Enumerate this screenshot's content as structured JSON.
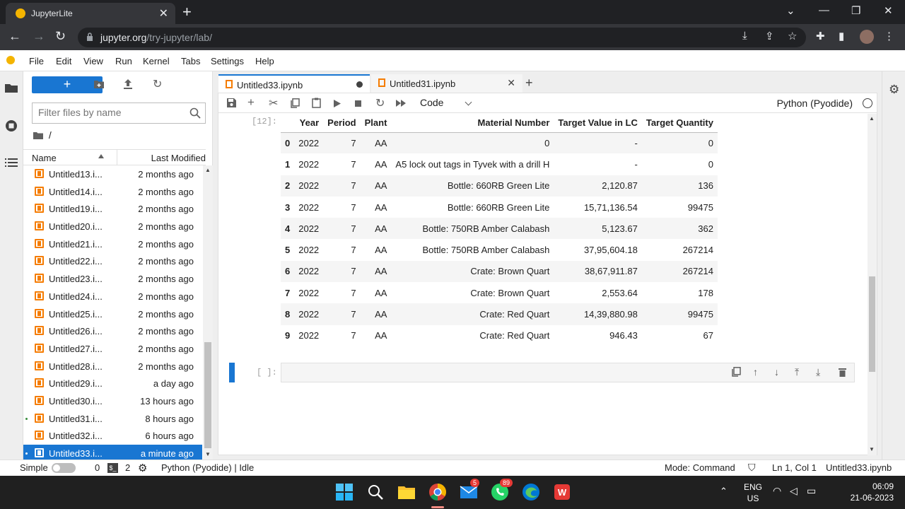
{
  "browser": {
    "tab_title": "JupyterLite",
    "url_domain": "jupyter.org",
    "url_path": "/try-jupyter/lab/"
  },
  "menu": [
    "File",
    "Edit",
    "View",
    "Run",
    "Kernel",
    "Tabs",
    "Settings",
    "Help"
  ],
  "filebrowser": {
    "new_label": "+",
    "filter_placeholder": "Filter files by name",
    "breadcrumb": "/",
    "col_name": "Name",
    "col_modified": "Last Modified",
    "files": [
      {
        "name": "Untitled13.i...",
        "modified": "2 months ago",
        "running": false,
        "selected": false
      },
      {
        "name": "Untitled14.i...",
        "modified": "2 months ago",
        "running": false,
        "selected": false
      },
      {
        "name": "Untitled19.i...",
        "modified": "2 months ago",
        "running": false,
        "selected": false
      },
      {
        "name": "Untitled20.i...",
        "modified": "2 months ago",
        "running": false,
        "selected": false
      },
      {
        "name": "Untitled21.i...",
        "modified": "2 months ago",
        "running": false,
        "selected": false
      },
      {
        "name": "Untitled22.i...",
        "modified": "2 months ago",
        "running": false,
        "selected": false
      },
      {
        "name": "Untitled23.i...",
        "modified": "2 months ago",
        "running": false,
        "selected": false
      },
      {
        "name": "Untitled24.i...",
        "modified": "2 months ago",
        "running": false,
        "selected": false
      },
      {
        "name": "Untitled25.i...",
        "modified": "2 months ago",
        "running": false,
        "selected": false
      },
      {
        "name": "Untitled26.i...",
        "modified": "2 months ago",
        "running": false,
        "selected": false
      },
      {
        "name": "Untitled27.i...",
        "modified": "2 months ago",
        "running": false,
        "selected": false
      },
      {
        "name": "Untitled28.i...",
        "modified": "2 months ago",
        "running": false,
        "selected": false
      },
      {
        "name": "Untitled29.i...",
        "modified": "a day ago",
        "running": false,
        "selected": false
      },
      {
        "name": "Untitled30.i...",
        "modified": "13 hours ago",
        "running": false,
        "selected": false
      },
      {
        "name": "Untitled31.i...",
        "modified": "8 hours ago",
        "running": true,
        "selected": false
      },
      {
        "name": "Untitled32.i...",
        "modified": "6 hours ago",
        "running": false,
        "selected": false
      },
      {
        "name": "Untitled33.i...",
        "modified": "a minute ago",
        "running": true,
        "selected": true
      }
    ]
  },
  "doc_tabs": [
    {
      "label": "Untitled33.ipynb",
      "active": true,
      "dirty": true
    },
    {
      "label": "Untitled31.ipynb",
      "active": false,
      "dirty": false
    }
  ],
  "notebook_toolbar": {
    "cell_type": "Code",
    "kernel_name": "Python (Pyodide)"
  },
  "output": {
    "prompt": "[12]:",
    "columns": [
      "",
      "Year",
      "Period",
      "Plant",
      "Material Number",
      "Target Value in LC",
      "Target Quantity"
    ],
    "rows": [
      [
        "0",
        "2022",
        "7",
        "AA",
        "0",
        "-",
        "0"
      ],
      [
        "1",
        "2022",
        "7",
        "AA",
        "A5 lock out tags in Tyvek with a drill H",
        "-",
        "0"
      ],
      [
        "2",
        "2022",
        "7",
        "AA",
        "Bottle: 660RB Green Lite",
        "2,120.87",
        "136"
      ],
      [
        "3",
        "2022",
        "7",
        "AA",
        "Bottle: 660RB Green Lite",
        "15,71,136.54",
        "99475"
      ],
      [
        "4",
        "2022",
        "7",
        "AA",
        "Bottle: 750RB Amber Calabash",
        "5,123.67",
        "362"
      ],
      [
        "5",
        "2022",
        "7",
        "AA",
        "Bottle: 750RB Amber Calabash",
        "37,95,604.18",
        "267214"
      ],
      [
        "6",
        "2022",
        "7",
        "AA",
        "Crate: Brown Quart",
        "38,67,911.87",
        "267214"
      ],
      [
        "7",
        "2022",
        "7",
        "AA",
        "Crate: Brown Quart",
        "2,553.64",
        "178"
      ],
      [
        "8",
        "2022",
        "7",
        "AA",
        "Crate: Red Quart",
        "14,39,880.98",
        "99475"
      ],
      [
        "9",
        "2022",
        "7",
        "AA",
        "Crate: Red Quart",
        "946.43",
        "67"
      ]
    ]
  },
  "empty_cell_prompt": "[ ]:",
  "statusbar": {
    "simple": "Simple",
    "terminals": "0",
    "kernels": "2",
    "kernel_status": "Python (Pyodide) | Idle",
    "mode": "Mode: Command",
    "cursor": "Ln 1, Col 1",
    "filename": "Untitled33.ipynb"
  },
  "taskbar": {
    "mail_badge": "5",
    "whatsapp_badge": "89",
    "lang_line1": "ENG",
    "lang_line2": "US",
    "time": "06:09",
    "date": "21-06-2023"
  }
}
